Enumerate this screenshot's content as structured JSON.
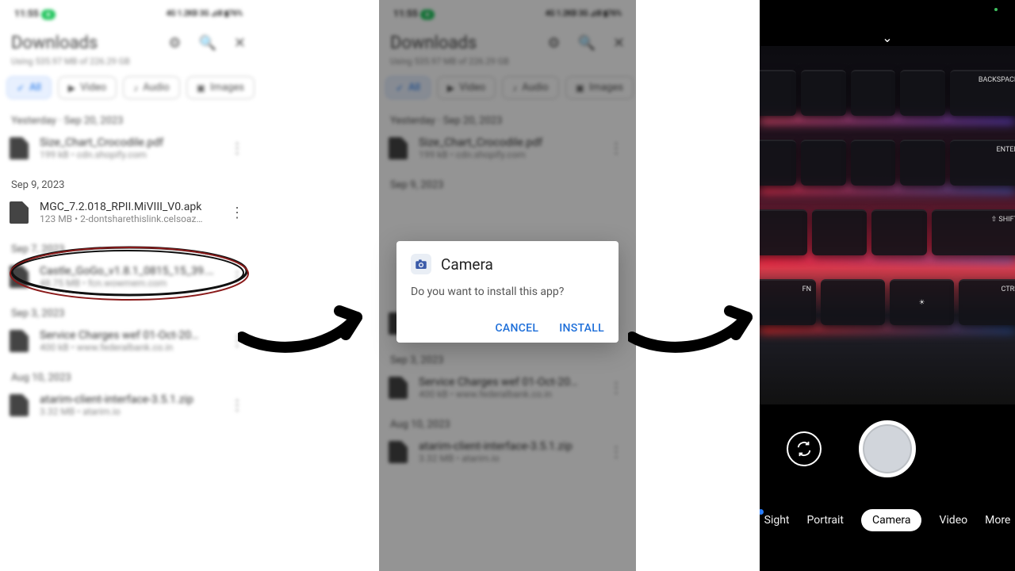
{
  "status": {
    "time": "11:55",
    "pill": "●",
    "right": "4G 1.2KB 3G ⊿ill ▮76%"
  },
  "downloads": {
    "title": "Downloads",
    "usage": "Using 535.97 MB of 226.29 GB",
    "chips": {
      "all": "All",
      "video": "Video",
      "audio": "Audio",
      "images": "Images"
    },
    "sections": [
      {
        "header": "Yesterday · Sep 20, 2023",
        "items": [
          {
            "name": "Size_Chart_Crocodile.pdf",
            "meta": "199 kB • cdn.shopify.com"
          }
        ]
      },
      {
        "header": "Sep 9, 2023",
        "items": [
          {
            "name": "MGC_7.2.018_RPII.MiVIII_V0.apk",
            "meta": "123 MB • 2-dontsharethislink.celsoaz…"
          }
        ]
      },
      {
        "header": "Sep 7, 2023",
        "items": [
          {
            "name": "Castle_GoGo_v1.8.1_0815_15_39.apk",
            "meta": "48.75 MB • fcn.wowmem.com"
          }
        ]
      },
      {
        "header": "Sep 3, 2023",
        "items": [
          {
            "name": "Service Charges wef 01-Oct-20…",
            "meta": "400 kB • www.federalbank.co.in"
          }
        ]
      },
      {
        "header": "Aug 10, 2023",
        "items": [
          {
            "name": "atarim-client-interface-3.5.1.zip",
            "meta": "3.32 MB • atarim.io"
          }
        ]
      }
    ]
  },
  "dialog": {
    "title": "Camera",
    "message": "Do you want to install this app?",
    "cancel": "CANCEL",
    "install": "INSTALL"
  },
  "camera": {
    "modes": {
      "sight": "Sight",
      "portrait": "Portrait",
      "camera": "Camera",
      "video": "Video",
      "more": "More"
    },
    "keycaps": {
      "backspace": "BACKSPACE",
      "enter": "ENTER",
      "shift": "⇧ SHIFT",
      "fn": "FN",
      "ctrl": "CTRL",
      "bright": "☀"
    }
  }
}
